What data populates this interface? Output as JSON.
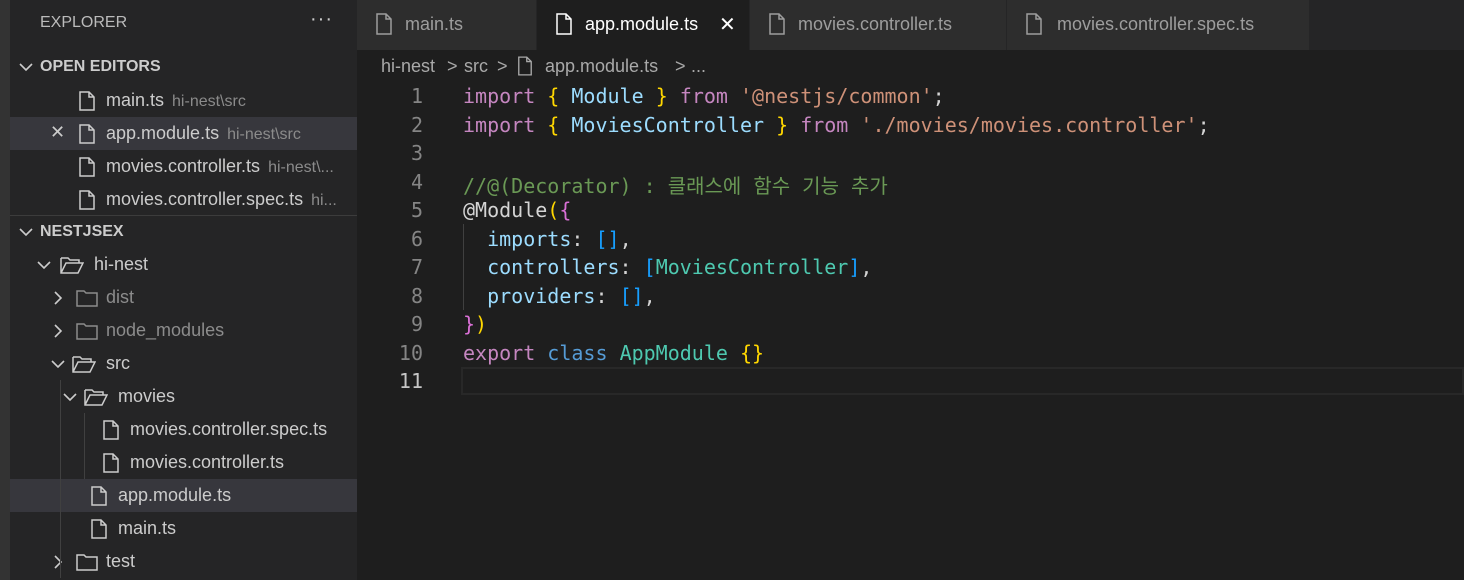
{
  "explorer": {
    "title": "EXPLORER",
    "more_icon": "ellipsis-icon",
    "open_editors": {
      "header": "OPEN EDITORS",
      "items": [
        {
          "name": "main.ts",
          "path": "hi-nest\\src"
        },
        {
          "name": "app.module.ts",
          "path": "hi-nest\\src"
        },
        {
          "name": "movies.controller.ts",
          "path": "hi-nest\\..."
        },
        {
          "name": "movies.controller.spec.ts",
          "path": "hi..."
        }
      ]
    },
    "workspace": {
      "header": "NESTJSEX",
      "tree": [
        {
          "label": "hi-nest",
          "type": "folder-open"
        },
        {
          "label": "dist",
          "type": "folder"
        },
        {
          "label": "node_modules",
          "type": "folder"
        },
        {
          "label": "src",
          "type": "folder-open"
        },
        {
          "label": "movies",
          "type": "folder-open"
        },
        {
          "label": "movies.controller.spec.ts",
          "type": "file"
        },
        {
          "label": "movies.controller.ts",
          "type": "file"
        },
        {
          "label": "app.module.ts",
          "type": "file",
          "selected": true
        },
        {
          "label": "main.ts",
          "type": "file"
        },
        {
          "label": "test",
          "type": "folder"
        }
      ]
    }
  },
  "tabs": [
    {
      "label": "main.ts",
      "active": false
    },
    {
      "label": "app.module.ts",
      "active": true,
      "close": "✕"
    },
    {
      "label": "movies.controller.ts",
      "active": false
    },
    {
      "label": "movies.controller.spec.ts",
      "active": false
    }
  ],
  "breadcrumb": {
    "parts": [
      "hi-nest",
      "src",
      "app.module.ts",
      "..."
    ],
    "separator": ">"
  },
  "editor": {
    "line_numbers": [
      "1",
      "2",
      "3",
      "4",
      "5",
      "6",
      "7",
      "8",
      "9",
      "10",
      "11"
    ],
    "current_line": "11",
    "lines": [
      [
        [
          "kw",
          "import"
        ],
        [
          "pl",
          " "
        ],
        [
          "b1",
          "{"
        ],
        [
          "pl",
          " "
        ],
        [
          "vr",
          "Module"
        ],
        [
          "pl",
          " "
        ],
        [
          "b1",
          "}"
        ],
        [
          "pl",
          " "
        ],
        [
          "kw",
          "from"
        ],
        [
          "pl",
          " "
        ],
        [
          "st",
          "'@nestjs/common'"
        ],
        [
          "pl",
          ";"
        ]
      ],
      [
        [
          "kw",
          "import"
        ],
        [
          "pl",
          " "
        ],
        [
          "b1",
          "{"
        ],
        [
          "pl",
          " "
        ],
        [
          "vr",
          "MoviesController"
        ],
        [
          "pl",
          " "
        ],
        [
          "b1",
          "}"
        ],
        [
          "pl",
          " "
        ],
        [
          "kw",
          "from"
        ],
        [
          "pl",
          " "
        ],
        [
          "st",
          "'./movies/movies.controller'"
        ],
        [
          "pl",
          ";"
        ]
      ],
      [],
      [
        [
          "cm",
          "//@(Decorator) : 클래스에 함수 기능 추가"
        ]
      ],
      [
        [
          "pl",
          "@"
        ],
        [
          "pl",
          "Module"
        ],
        [
          "b1",
          "("
        ],
        [
          "b2",
          "{"
        ]
      ],
      [
        [
          "pl",
          "  "
        ],
        [
          "vr",
          "imports"
        ],
        [
          "pl",
          ": "
        ],
        [
          "b3",
          "[]"
        ],
        [
          "pl",
          ","
        ]
      ],
      [
        [
          "pl",
          "  "
        ],
        [
          "vr",
          "controllers"
        ],
        [
          "pl",
          ": "
        ],
        [
          "b3",
          "["
        ],
        [
          "ty",
          "MoviesController"
        ],
        [
          "b3",
          "]"
        ],
        [
          "pl",
          ","
        ]
      ],
      [
        [
          "pl",
          "  "
        ],
        [
          "vr",
          "providers"
        ],
        [
          "pl",
          ": "
        ],
        [
          "b3",
          "[]"
        ],
        [
          "pl",
          ","
        ]
      ],
      [
        [
          "b2",
          "}"
        ],
        [
          "b1",
          ")"
        ]
      ],
      [
        [
          "kw",
          "export"
        ],
        [
          "pl",
          " "
        ],
        [
          "sk",
          "class"
        ],
        [
          "pl",
          " "
        ],
        [
          "ty",
          "AppModule"
        ],
        [
          "pl",
          " "
        ],
        [
          "b1",
          "{}"
        ]
      ],
      []
    ]
  },
  "colors": {
    "editor_bg": "#1e1e1e",
    "sidebar_bg": "#252526",
    "selection_bg": "#37373d",
    "keyword": "#c586c0",
    "string": "#ce9178",
    "variable": "#9cdcfe",
    "type": "#4ec9b0",
    "comment": "#6a9955"
  }
}
